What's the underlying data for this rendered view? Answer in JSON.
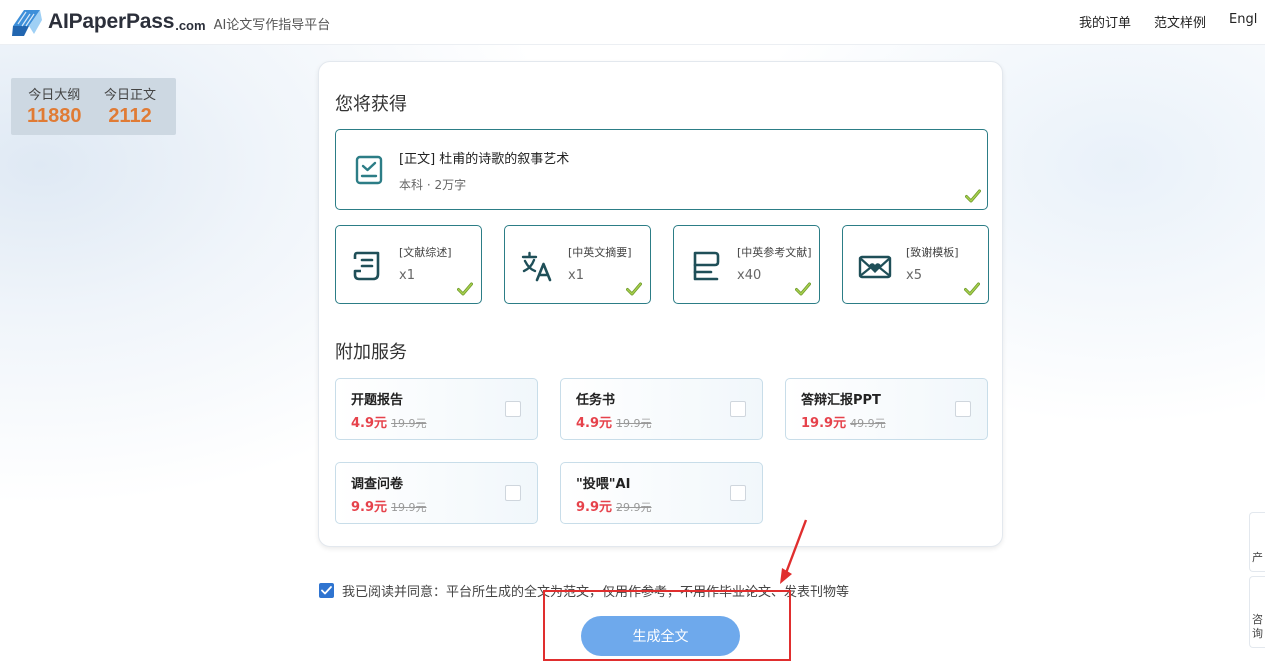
{
  "header": {
    "logo_text": "AIPaperPass",
    "logo_domain": ".com",
    "tagline": "AI论文写作指导平台",
    "nav": [
      "我的订单",
      "范文样例",
      "Engl"
    ]
  },
  "stats": [
    {
      "label": "今日大纲",
      "value": "11880"
    },
    {
      "label": "今日正文",
      "value": "2112"
    }
  ],
  "receive": {
    "title": "您将获得",
    "main": {
      "title": "[正文] 杜甫的诗歌的叙事艺术",
      "meta": "本科 · 2万字"
    },
    "items": [
      {
        "label": "[文献综述]",
        "count": "x1",
        "icon": "document-list-icon"
      },
      {
        "label": "[中英文摘要]",
        "count": "x1",
        "icon": "translate-icon"
      },
      {
        "label": "[中英参考文献]",
        "count": "x40",
        "icon": "reference-icon"
      },
      {
        "label": "[致谢模板]",
        "count": "x5",
        "icon": "heart-envelope-icon"
      }
    ]
  },
  "addons": {
    "title": "附加服务",
    "items": [
      {
        "name": "开题报告",
        "price": "4.9元",
        "original": "19.9元"
      },
      {
        "name": "任务书",
        "price": "4.9元",
        "original": "19.9元"
      },
      {
        "name": "答辩汇报PPT",
        "price": "19.9元",
        "original": "49.9元"
      },
      {
        "name": "调查问卷",
        "price": "9.9元",
        "original": "19.9元"
      },
      {
        "name": "\"投喂\"AI",
        "price": "9.9元",
        "original": "29.9元"
      }
    ]
  },
  "agreement": {
    "text": "我已阅读并同意：平台所生成的全文为范文，仅用作参考，不用作毕业论文、发表刊物等",
    "checked": true
  },
  "generate_button": "生成全文",
  "side_tabs": [
    "产",
    "咨询"
  ],
  "colors": {
    "accent": "#2c7d86",
    "stat_number": "#e07b35",
    "price": "#e6424b",
    "button": "#6ea9ec",
    "check": "#8cb93a",
    "annotation": "#e02e2e"
  }
}
